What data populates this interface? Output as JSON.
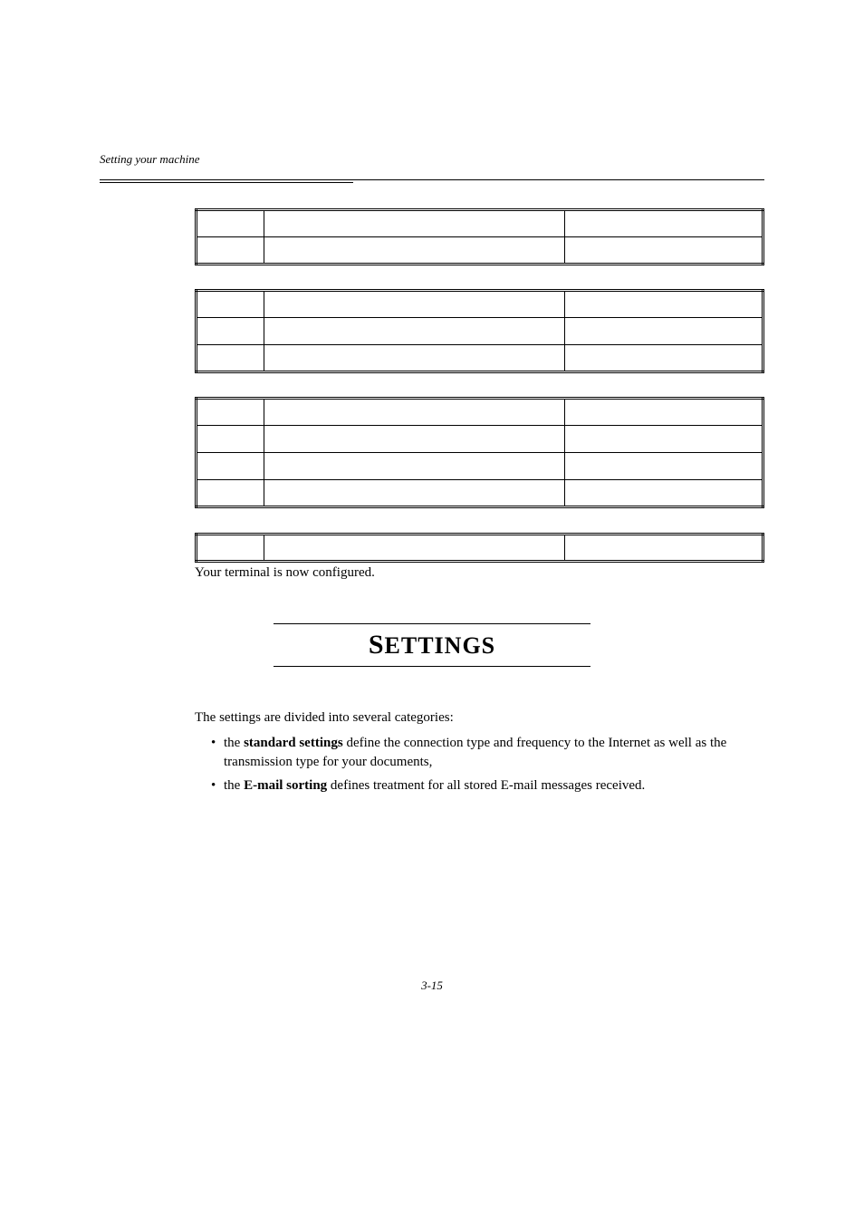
{
  "header": {
    "section_label": "Setting your machine"
  },
  "tables": {
    "t1_rows": 2,
    "t2_rows": 3,
    "t3_rows": 4,
    "t4_rows": 1
  },
  "configured_text": "Your terminal is now configured.",
  "settings": {
    "title_big": "S",
    "title_rest": "ETTINGS"
  },
  "body": {
    "intro": "The settings are divided into several categories:",
    "bullet1_prefix": "the ",
    "bullet1_bold": "standard settings",
    "bullet1_rest": " define the connection type and frequency to the Internet as well as the transmission type for your documents,",
    "bullet2_prefix": "the  ",
    "bullet2_bold": "E-mail sorting",
    "bullet2_rest": " defines treatment for all stored E-mail messages received."
  },
  "page_number": "3-15"
}
